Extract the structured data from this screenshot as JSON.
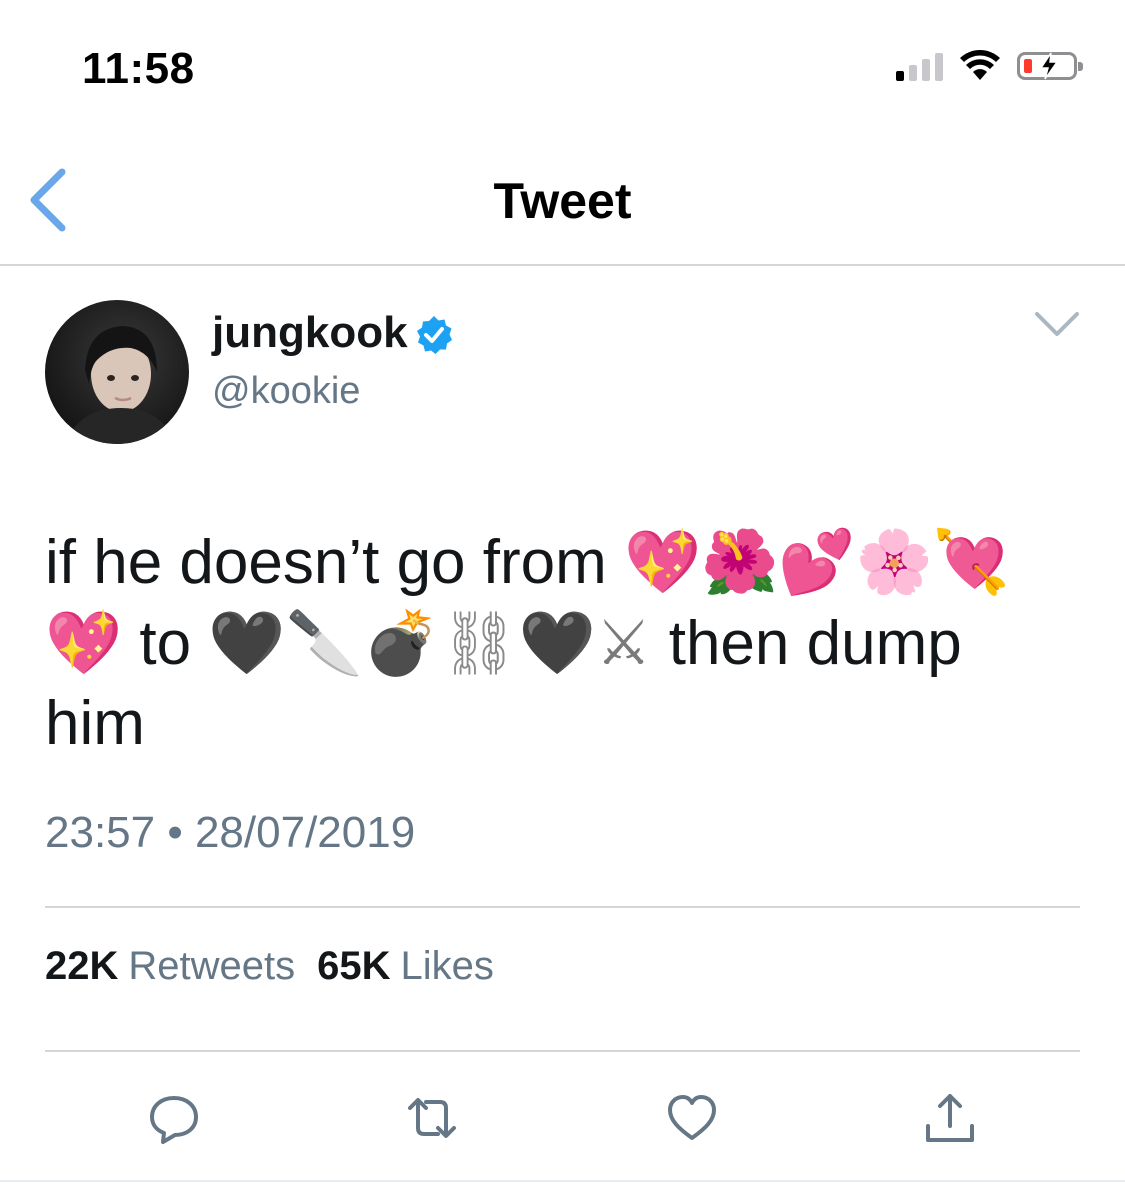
{
  "status_bar": {
    "time": "11:58",
    "signal_bars_on": 1,
    "signal_bars_total": 4,
    "battery_level": 0.1,
    "charging": true
  },
  "nav": {
    "title": "Tweet",
    "back_icon": "chevron-left-icon"
  },
  "tweet": {
    "author": {
      "display_name": "jungkook",
      "handle": "@kookie",
      "verified": true
    },
    "text_lines": [
      [
        "if he doesn’t go from ",
        "💖",
        "🌺",
        "💕",
        "🌸",
        "💘"
      ],
      [
        "💖",
        " to ",
        "🖤",
        "🔪",
        "💣",
        "⛓",
        "🖤",
        "⚔",
        " then dump"
      ],
      [
        "him"
      ]
    ],
    "timestamp": "23:57 • 28/07/2019",
    "stats": {
      "retweets_count": "22K",
      "retweets_label": "Retweets",
      "likes_count": "65K",
      "likes_label": "Likes"
    }
  },
  "actions": [
    "reply-icon",
    "retweet-icon",
    "like-icon",
    "share-icon"
  ],
  "colors": {
    "accent": "#1da1f2",
    "back_chevron": "#6aa7e8",
    "secondary_text": "#657786",
    "divider": "#d3d7da",
    "icon_gray": "#657786"
  }
}
